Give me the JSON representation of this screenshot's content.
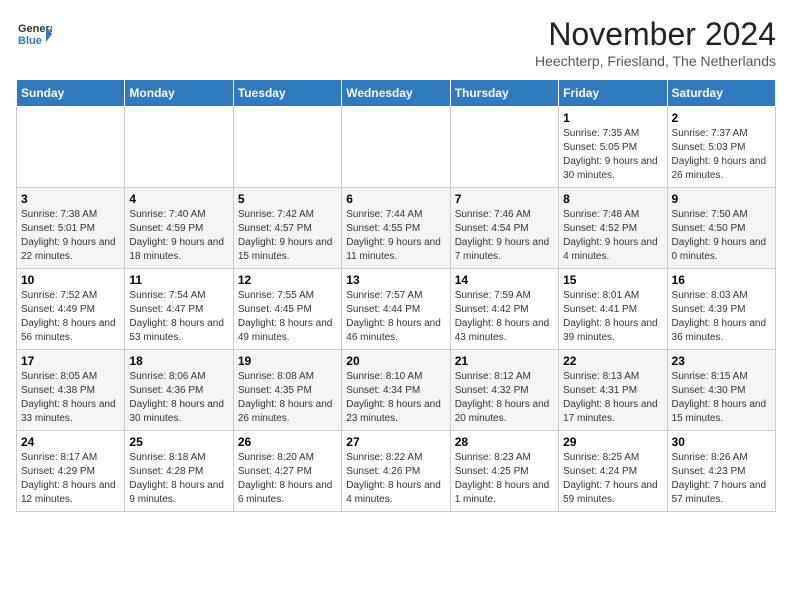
{
  "header": {
    "logo_line1": "General",
    "logo_line2": "Blue",
    "month": "November 2024",
    "location": "Heechterp, Friesland, The Netherlands"
  },
  "weekdays": [
    "Sunday",
    "Monday",
    "Tuesday",
    "Wednesday",
    "Thursday",
    "Friday",
    "Saturday"
  ],
  "weeks": [
    [
      {
        "day": "",
        "info": ""
      },
      {
        "day": "",
        "info": ""
      },
      {
        "day": "",
        "info": ""
      },
      {
        "day": "",
        "info": ""
      },
      {
        "day": "",
        "info": ""
      },
      {
        "day": "1",
        "info": "Sunrise: 7:35 AM\nSunset: 5:05 PM\nDaylight: 9 hours and 30 minutes."
      },
      {
        "day": "2",
        "info": "Sunrise: 7:37 AM\nSunset: 5:03 PM\nDaylight: 9 hours and 26 minutes."
      }
    ],
    [
      {
        "day": "3",
        "info": "Sunrise: 7:38 AM\nSunset: 5:01 PM\nDaylight: 9 hours and 22 minutes."
      },
      {
        "day": "4",
        "info": "Sunrise: 7:40 AM\nSunset: 4:59 PM\nDaylight: 9 hours and 18 minutes."
      },
      {
        "day": "5",
        "info": "Sunrise: 7:42 AM\nSunset: 4:57 PM\nDaylight: 9 hours and 15 minutes."
      },
      {
        "day": "6",
        "info": "Sunrise: 7:44 AM\nSunset: 4:55 PM\nDaylight: 9 hours and 11 minutes."
      },
      {
        "day": "7",
        "info": "Sunrise: 7:46 AM\nSunset: 4:54 PM\nDaylight: 9 hours and 7 minutes."
      },
      {
        "day": "8",
        "info": "Sunrise: 7:48 AM\nSunset: 4:52 PM\nDaylight: 9 hours and 4 minutes."
      },
      {
        "day": "9",
        "info": "Sunrise: 7:50 AM\nSunset: 4:50 PM\nDaylight: 9 hours and 0 minutes."
      }
    ],
    [
      {
        "day": "10",
        "info": "Sunrise: 7:52 AM\nSunset: 4:49 PM\nDaylight: 8 hours and 56 minutes."
      },
      {
        "day": "11",
        "info": "Sunrise: 7:54 AM\nSunset: 4:47 PM\nDaylight: 8 hours and 53 minutes."
      },
      {
        "day": "12",
        "info": "Sunrise: 7:55 AM\nSunset: 4:45 PM\nDaylight: 8 hours and 49 minutes."
      },
      {
        "day": "13",
        "info": "Sunrise: 7:57 AM\nSunset: 4:44 PM\nDaylight: 8 hours and 46 minutes."
      },
      {
        "day": "14",
        "info": "Sunrise: 7:59 AM\nSunset: 4:42 PM\nDaylight: 8 hours and 43 minutes."
      },
      {
        "day": "15",
        "info": "Sunrise: 8:01 AM\nSunset: 4:41 PM\nDaylight: 8 hours and 39 minutes."
      },
      {
        "day": "16",
        "info": "Sunrise: 8:03 AM\nSunset: 4:39 PM\nDaylight: 8 hours and 36 minutes."
      }
    ],
    [
      {
        "day": "17",
        "info": "Sunrise: 8:05 AM\nSunset: 4:38 PM\nDaylight: 8 hours and 33 minutes."
      },
      {
        "day": "18",
        "info": "Sunrise: 8:06 AM\nSunset: 4:36 PM\nDaylight: 8 hours and 30 minutes."
      },
      {
        "day": "19",
        "info": "Sunrise: 8:08 AM\nSunset: 4:35 PM\nDaylight: 8 hours and 26 minutes."
      },
      {
        "day": "20",
        "info": "Sunrise: 8:10 AM\nSunset: 4:34 PM\nDaylight: 8 hours and 23 minutes."
      },
      {
        "day": "21",
        "info": "Sunrise: 8:12 AM\nSunset: 4:32 PM\nDaylight: 8 hours and 20 minutes."
      },
      {
        "day": "22",
        "info": "Sunrise: 8:13 AM\nSunset: 4:31 PM\nDaylight: 8 hours and 17 minutes."
      },
      {
        "day": "23",
        "info": "Sunrise: 8:15 AM\nSunset: 4:30 PM\nDaylight: 8 hours and 15 minutes."
      }
    ],
    [
      {
        "day": "24",
        "info": "Sunrise: 8:17 AM\nSunset: 4:29 PM\nDaylight: 8 hours and 12 minutes."
      },
      {
        "day": "25",
        "info": "Sunrise: 8:18 AM\nSunset: 4:28 PM\nDaylight: 8 hours and 9 minutes."
      },
      {
        "day": "26",
        "info": "Sunrise: 8:20 AM\nSunset: 4:27 PM\nDaylight: 8 hours and 6 minutes."
      },
      {
        "day": "27",
        "info": "Sunrise: 8:22 AM\nSunset: 4:26 PM\nDaylight: 8 hours and 4 minutes."
      },
      {
        "day": "28",
        "info": "Sunrise: 8:23 AM\nSunset: 4:25 PM\nDaylight: 8 hours and 1 minute."
      },
      {
        "day": "29",
        "info": "Sunrise: 8:25 AM\nSunset: 4:24 PM\nDaylight: 7 hours and 59 minutes."
      },
      {
        "day": "30",
        "info": "Sunrise: 8:26 AM\nSunset: 4:23 PM\nDaylight: 7 hours and 57 minutes."
      }
    ]
  ]
}
